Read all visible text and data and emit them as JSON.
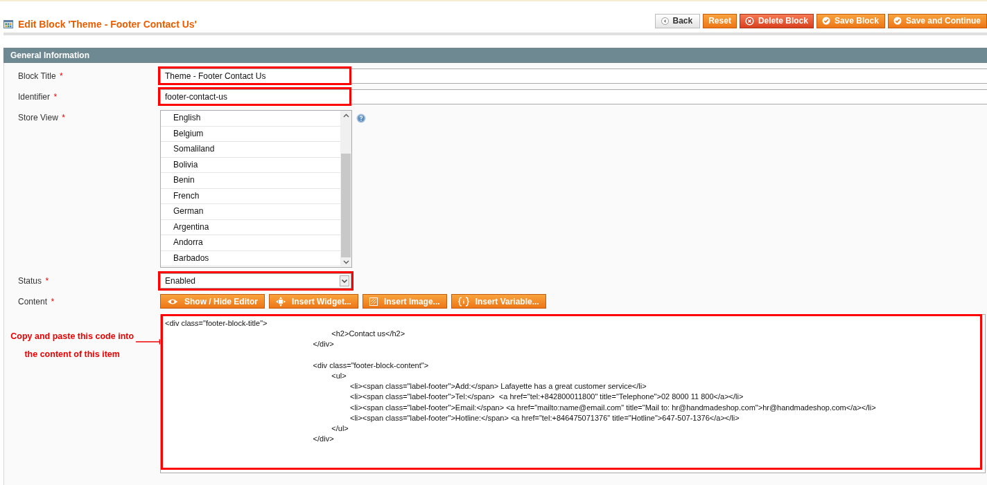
{
  "page_title": "Edit Block 'Theme - Footer Contact Us'",
  "actions": [
    {
      "label": "Back",
      "kind": "back"
    },
    {
      "label": "Reset",
      "kind": "plain"
    },
    {
      "label": "Delete Block",
      "kind": "delete"
    },
    {
      "label": "Save Block",
      "kind": "save"
    },
    {
      "label": "Save and Continue",
      "kind": "save"
    }
  ],
  "section": {
    "title": "General Information"
  },
  "fields": [
    {
      "kind": "text",
      "label": "Block Title",
      "required": "*",
      "value": "Theme - Footer Contact Us",
      "highlighted": true
    },
    {
      "kind": "text",
      "label": "Identifier",
      "required": "*",
      "value": "footer-contact-us",
      "highlighted": true
    },
    {
      "kind": "multiselect",
      "label": "Store View",
      "required": "*",
      "help": true,
      "options": [
        "English",
        "Belgium",
        "Somaliland",
        "Bolivia",
        "Benin",
        "French",
        "German",
        "Argentina",
        "Andorra",
        "Barbados"
      ]
    },
    {
      "kind": "select",
      "label": "Status",
      "required": "*",
      "value": "Enabled",
      "highlighted": true
    },
    {
      "kind": "editor",
      "label": "Content",
      "required": "*",
      "highlighted": true,
      "buttons": [
        {
          "label": "Show / Hide Editor",
          "kind": "eye"
        },
        {
          "label": "Insert Widget...",
          "kind": "widget"
        },
        {
          "label": "Insert Image...",
          "kind": "image"
        },
        {
          "label": "Insert Variable...",
          "kind": "variable"
        }
      ],
      "value": "<div class=\"footer-block-title\">\n\t\t\t\t\t\t\t\t\t<h2>Contact us</h2>\n\t\t\t\t\t\t\t\t</div>\n\n\t\t\t\t\t\t\t\t<div class=\"footer-block-content\">\n\t\t\t\t\t\t\t\t\t<ul>\n\t\t\t\t\t\t\t\t\t\t<li><span class=\"label-footer\">Add:</span> Lafayette has a great customer service</li>\n\t\t\t\t\t\t\t\t\t\t<li><span class=\"label-footer\">Tel:</span>  <a href=\"tel:+842800011800\" title=\"Telephone\">02 8000 11 800</a></li>\n\t\t\t\t\t\t\t\t\t\t<li><span class=\"label-footer\">Email:</span> <a href=\"mailto:name@email.com\" title=\"Mail to: hr@handmadeshop.com\">hr@handmadeshop.com</a></li>\n\t\t\t\t\t\t\t\t\t\t<li><span class=\"label-footer\">Hotline:</span> <a href=\"tel:+846475071376\" title=\"Hotline\">647-507-1376</a></li>\n\t\t\t\t\t\t\t\t\t</ul>\n\t\t\t\t\t\t\t\t</div>",
      "note": "Copy and paste this code into the content of this item"
    }
  ]
}
